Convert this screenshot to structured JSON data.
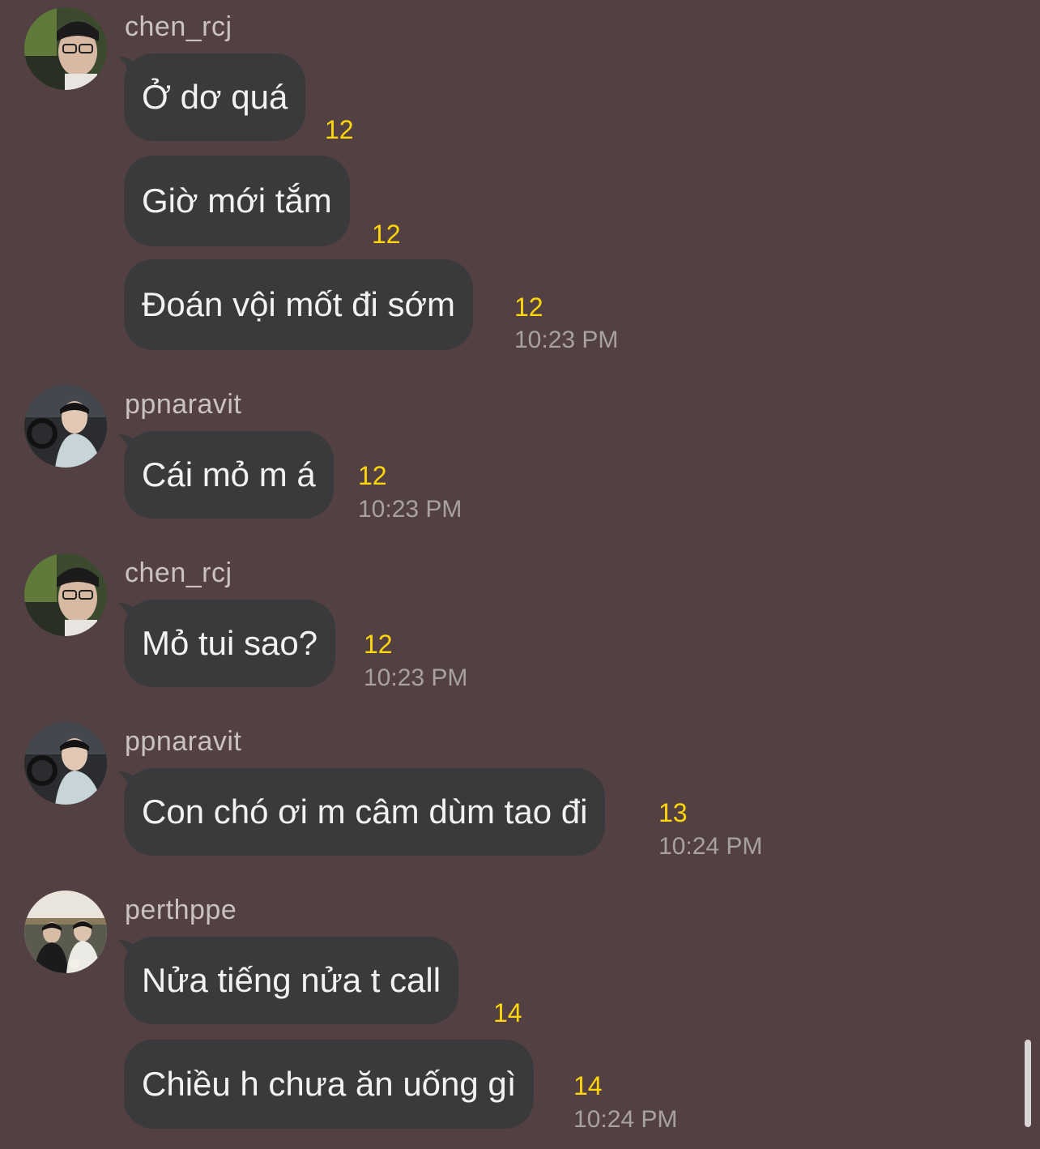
{
  "messages": [
    {
      "sender": "chen_rcj",
      "avatar": "chen-rcj-avatar",
      "bubbles": [
        {
          "text": "Ở dơ quá",
          "count": "12"
        },
        {
          "text": "Giờ mới tắm",
          "count": "12"
        },
        {
          "text": "Đoán vội mốt đi sớm",
          "count": "12"
        }
      ],
      "time": "10:23 PM"
    },
    {
      "sender": "ppnaravit",
      "avatar": "ppnaravit-avatar",
      "bubbles": [
        {
          "text": "Cái mỏ m á",
          "count": "12"
        }
      ],
      "time": "10:23 PM"
    },
    {
      "sender": "chen_rcj",
      "avatar": "chen-rcj-avatar",
      "bubbles": [
        {
          "text": "Mỏ tui sao?",
          "count": "12"
        }
      ],
      "time": "10:23 PM"
    },
    {
      "sender": "ppnaravit",
      "avatar": "ppnaravit-avatar",
      "bubbles": [
        {
          "text": "Con chó ơi m câm dùm tao đi",
          "count": "13"
        }
      ],
      "time": "10:24 PM"
    },
    {
      "sender": "perthppe",
      "avatar": "perthppe-avatar",
      "bubbles": [
        {
          "text": "Nửa tiếng nửa t call",
          "count": "14"
        },
        {
          "text": "Chiều h chưa ăn uống gì",
          "count": "14"
        }
      ],
      "time": "10:24 PM"
    }
  ],
  "colors": {
    "background": "#534042",
    "bubble": "#3a3a3c",
    "bubble_text": "#f2f2f2",
    "read_count": "#ffd60a",
    "timestamp": "#a8a1a2",
    "sender_name": "#c9c1c2"
  }
}
